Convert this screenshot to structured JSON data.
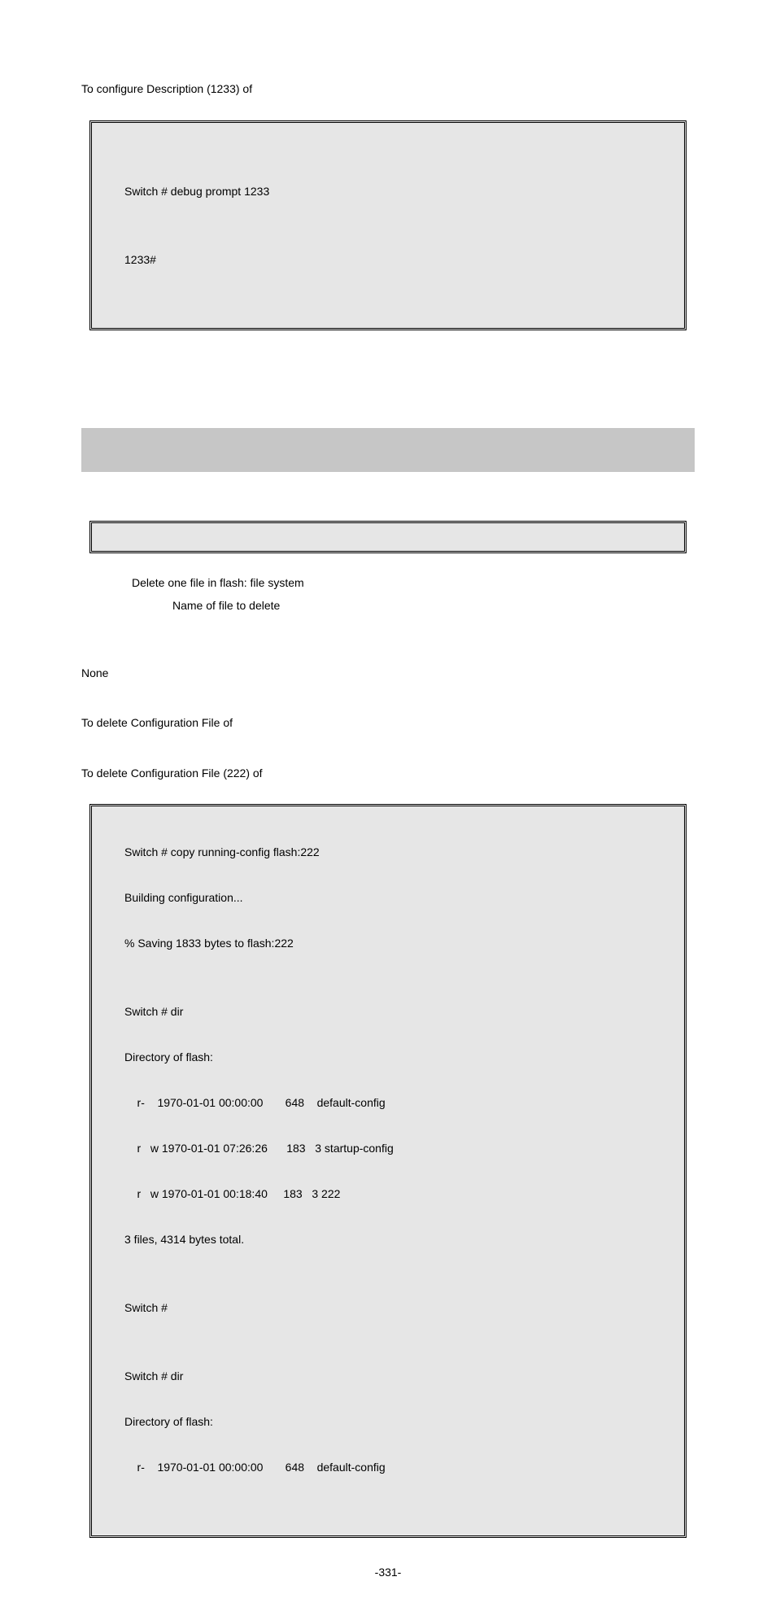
{
  "intro_line": "To configure Description (1233) of",
  "code1_l1": "Switch # debug prompt 1233",
  "code1_l2": "1233#",
  "desc_l1": "Delete one file in flash: file system",
  "desc_l2": "Name of file to delete",
  "none_label": "None",
  "delete_line": "To delete Configuration File of",
  "delete_line2": "To delete Configuration File (222) of",
  "code2": {
    "l1": "Switch # copy running-config flash:222",
    "l2": "Building configuration...",
    "l3": "% Saving 1833 bytes to flash:222",
    "l4": "",
    "l5": "Switch # dir",
    "l6": "Directory of flash:",
    "l7": "    r-    1970-01-01 00:00:00       648    default-config",
    "l8": "    r   w 1970-01-01 07:26:26      183   3 startup-config",
    "l9": "    r   w 1970-01-01 00:18:40     183   3 222",
    "l10": "3 files, 4314 bytes total.",
    "l11": "",
    "l12": "Switch #",
    "l13": "",
    "l14": "Switch # dir",
    "l15": "Directory of flash:",
    "l16": "    r-    1970-01-01 00:00:00       648    default-config"
  },
  "page_number": "-331-"
}
